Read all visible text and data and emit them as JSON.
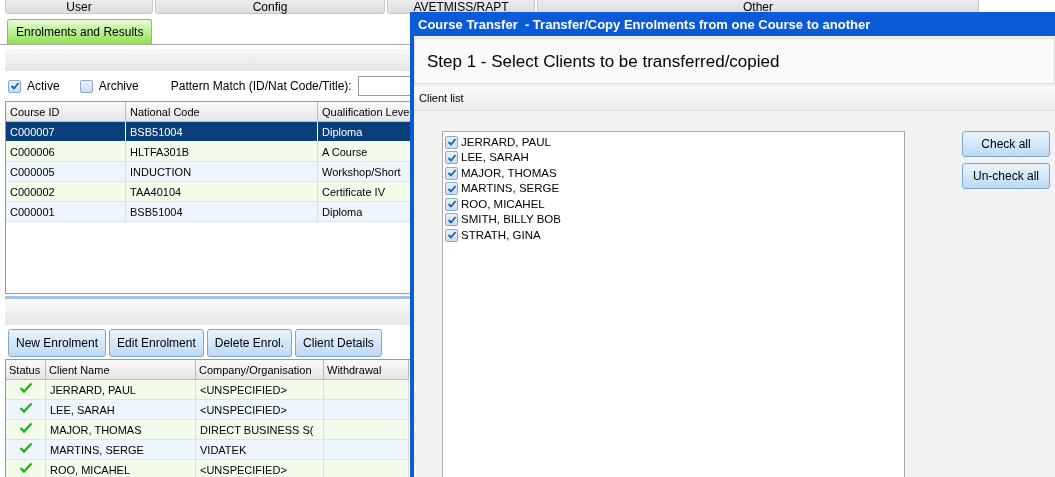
{
  "top_tabs": [
    {
      "label": "User"
    },
    {
      "label": "Config"
    },
    {
      "label": "AVETMISS/RAPT"
    },
    {
      "label": "Other"
    }
  ],
  "tabs": [
    {
      "label": "Enrolments and Results",
      "selected": true
    }
  ],
  "filters": {
    "active": {
      "label": "Active",
      "checked": true
    },
    "archive": {
      "label": "Archive",
      "checked": false
    },
    "pattern_match": {
      "label": "Pattern Match (ID/Nat Code/Title):"
    }
  },
  "course_table": {
    "columns": [
      "Course ID",
      "National Code",
      "Qualification Leve"
    ],
    "rows": [
      {
        "cells": [
          "C000007",
          "BSB51004",
          "Diploma"
        ],
        "selected": true
      },
      {
        "cells": [
          "C000006",
          "HLTFA301B",
          "A Course"
        ],
        "selected": false
      },
      {
        "cells": [
          "C000005",
          "INDUCTION",
          "Workshop/Short"
        ],
        "selected": false
      },
      {
        "cells": [
          "C000002",
          "TAA40104",
          "Certificate IV"
        ],
        "selected": false
      },
      {
        "cells": [
          "C000001",
          "BSB51004",
          "Diploma"
        ],
        "selected": false
      }
    ]
  },
  "enrolment_buttons": [
    "New Enrolment",
    "Edit Enrolment",
    "Delete Enrol.",
    "Client Details"
  ],
  "client_table": {
    "columns": [
      "Status",
      "Client Name",
      "Company/Organisation",
      "Withdrawal"
    ],
    "rows": [
      {
        "completed": true,
        "cells": [
          "",
          "JERRARD, PAUL",
          "<UNSPECIFIED>"
        ]
      },
      {
        "completed": true,
        "cells": [
          "",
          "LEE, SARAH",
          "<UNSPECIFIED>"
        ]
      },
      {
        "completed": true,
        "cells": [
          "",
          "MAJOR, THOMAS",
          "DIRECT BUSINESS S("
        ]
      },
      {
        "completed": true,
        "cells": [
          "",
          "MARTINS, SERGE",
          "VIDATEK"
        ]
      },
      {
        "completed": true,
        "cells": [
          "",
          "ROO, MICAHEL",
          "<UNSPECIFIED>"
        ]
      }
    ]
  },
  "dialog": {
    "title": "Course Transfer  - Transfer/Copy Enrolments from one Course to another",
    "step_title": "Step 1 - Select Clients to be transferred/copied",
    "section_label": "Client list",
    "clients": [
      {
        "name": "JERRARD, PAUL",
        "checked": true
      },
      {
        "name": "LEE, SARAH",
        "checked": true
      },
      {
        "name": "MAJOR, THOMAS",
        "checked": true
      },
      {
        "name": "MARTINS, SERGE",
        "checked": true
      },
      {
        "name": "ROO, MICAHEL",
        "checked": true
      },
      {
        "name": "SMITH, BILLY BOB",
        "checked": true
      },
      {
        "name": "STRATH, GINA",
        "checked": true
      }
    ],
    "buttons": [
      "Check all",
      "Un-check all"
    ]
  }
}
